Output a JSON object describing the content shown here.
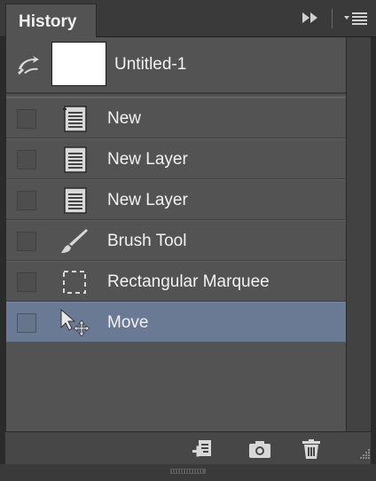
{
  "panel": {
    "tab_title": "History"
  },
  "snapshot": {
    "name": "Untitled-1",
    "thumbnail_color": "#ffffff"
  },
  "history": {
    "items": [
      {
        "label": "New",
        "icon": "document-icon",
        "selected": false
      },
      {
        "label": "New Layer",
        "icon": "document-icon",
        "selected": false
      },
      {
        "label": "New Layer",
        "icon": "document-icon",
        "selected": false
      },
      {
        "label": "Brush Tool",
        "icon": "brush-icon",
        "selected": false
      },
      {
        "label": "Rectangular Marquee",
        "icon": "marquee-icon",
        "selected": false
      },
      {
        "label": "Move",
        "icon": "move-tool-icon",
        "selected": true
      }
    ]
  },
  "colors": {
    "selection": "#6b7a94",
    "panel_bg": "#535353"
  },
  "footer": {
    "buttons": [
      "new-document-from-state-icon",
      "camera-icon",
      "trash-icon"
    ]
  }
}
